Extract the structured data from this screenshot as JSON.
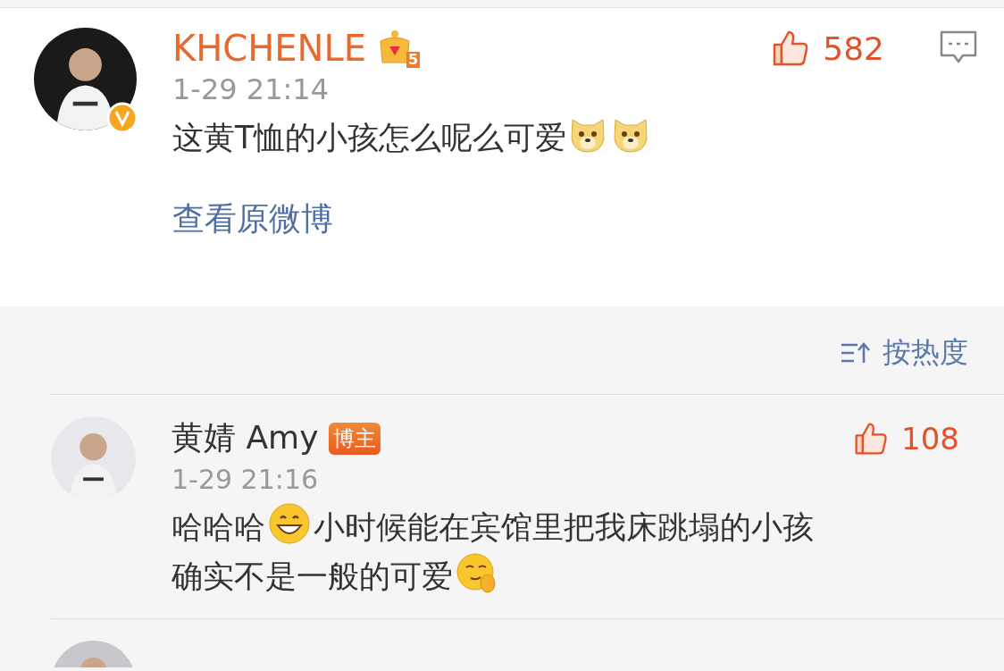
{
  "post": {
    "author": "KHCHENLE",
    "level": "5",
    "verified": true,
    "time": "1-29 21:14",
    "likes": "582",
    "content": [
      {
        "kind": "text",
        "text": "这黄T恤的小孩怎么呢么可爱"
      },
      {
        "kind": "doge"
      },
      {
        "kind": "doge"
      }
    ],
    "link": "查看原微博"
  },
  "sort": {
    "label": "按热度"
  },
  "replies": [
    {
      "author": "黄婧 Amy",
      "badge": "博主",
      "time": "1-29 21:16",
      "likes": "108",
      "content": [
        {
          "kind": "text",
          "text": "哈哈哈"
        },
        {
          "kind": "grin"
        },
        {
          "kind": "text",
          "text": "小时候能在宾馆里把我床跳塌的小孩"
        },
        {
          "kind": "text",
          "text": "确实不是一般的可爱"
        },
        {
          "kind": "smirk"
        }
      ]
    }
  ]
}
